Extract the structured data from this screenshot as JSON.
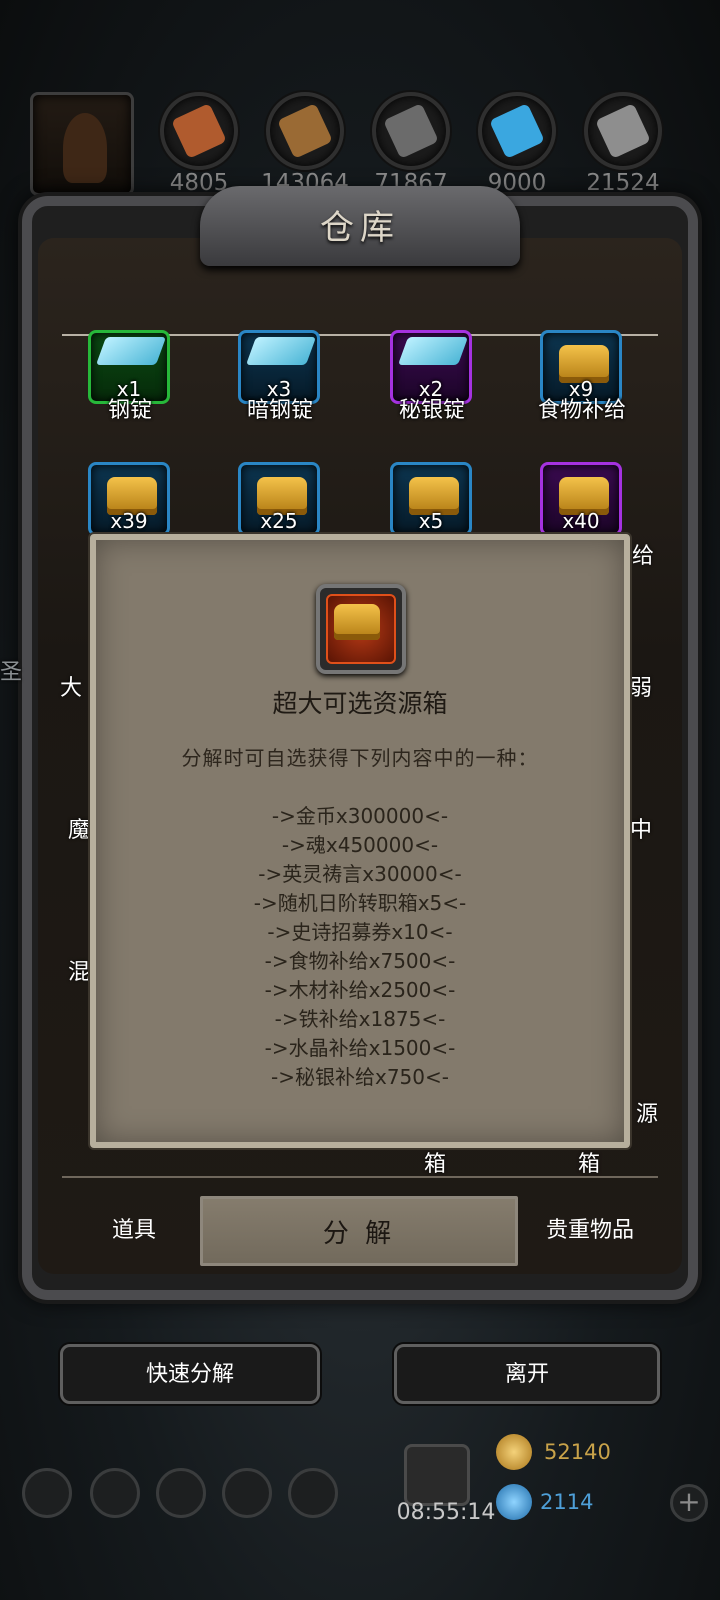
{
  "resources": [
    {
      "name": "leather-icon",
      "count": "4805",
      "color": "#b05b2e"
    },
    {
      "name": "wood-icon",
      "count": "143064",
      "color": "#9a6a34"
    },
    {
      "name": "iron-icon",
      "count": "71867",
      "color": "#6b6b6b"
    },
    {
      "name": "crystal-icon",
      "count": "9000",
      "color": "#3aa7e0"
    },
    {
      "name": "mithril-icon",
      "count": "21524",
      "color": "#8e8e8e"
    }
  ],
  "panel": {
    "title": "仓库"
  },
  "items_row1": [
    {
      "qty": "x1",
      "label": "钢锭",
      "rarity": "green"
    },
    {
      "qty": "x3",
      "label": "暗钢锭",
      "rarity": "blue"
    },
    {
      "qty": "x2",
      "label": "秘银锭",
      "rarity": "purple"
    },
    {
      "qty": "x9",
      "label": "食物补给",
      "rarity": "blue"
    }
  ],
  "items_row2": [
    {
      "qty": "x39",
      "rarity": "blue"
    },
    {
      "qty": "x25",
      "rarity": "blue"
    },
    {
      "qty": "x5",
      "rarity": "blue"
    },
    {
      "qty": "x40",
      "rarity": "purple"
    }
  ],
  "partial_labels": {
    "r2_right": "给",
    "left_1": "大",
    "left_2": "魔",
    "left_3": "混",
    "right_1": "弱",
    "right_2": "中",
    "right_3": "源",
    "bottom_1": "箱",
    "bottom_2": "箱",
    "far_left": "圣"
  },
  "tabs": {
    "left": "道具",
    "center": "分 解",
    "right": "贵重物品"
  },
  "actions": {
    "quick_decompose": "快速分解",
    "leave": "离开"
  },
  "hud": {
    "time": "08:55:14",
    "gold": "52140",
    "gems": "2114",
    "plus": "+"
  },
  "modal": {
    "title": "超大可选资源箱",
    "description": "分解时可自选获得下列内容中的一种：",
    "rewards": [
      "->金币x300000<-",
      "->魂x450000<-",
      "->英灵祷言x30000<-",
      "->随机日阶转职箱x5<-",
      "->史诗招募券x10<-",
      "->食物补给x7500<-",
      "->木材补给x2500<-",
      "->铁补给x1875<-",
      "->水晶补给x1500<-",
      "->秘银补给x750<-"
    ]
  }
}
